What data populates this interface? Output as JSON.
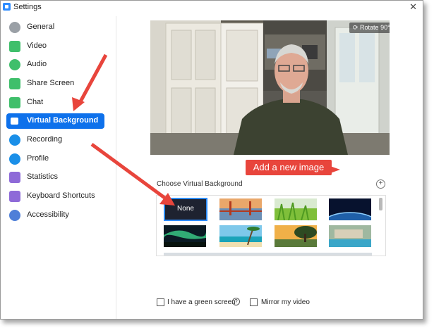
{
  "window": {
    "title": "Settings",
    "close_glyph": "✕"
  },
  "sidebar": {
    "items": [
      {
        "label": "General",
        "icon": "gear-icon",
        "color": "#9aa0a6"
      },
      {
        "label": "Video",
        "icon": "video-camera-icon",
        "color": "#3fbf6b"
      },
      {
        "label": "Audio",
        "icon": "headphones-icon",
        "color": "#3fbf6b"
      },
      {
        "label": "Share Screen",
        "icon": "share-screen-icon",
        "color": "#3fbf6b"
      },
      {
        "label": "Chat",
        "icon": "chat-bubble-icon",
        "color": "#3fbf6b"
      },
      {
        "label": "Virtual Background",
        "icon": "person-card-icon",
        "color": "#ffffff",
        "active": true
      },
      {
        "label": "Recording",
        "icon": "record-icon",
        "color": "#1a8fe8"
      },
      {
        "label": "Profile",
        "icon": "profile-icon",
        "color": "#1a8fe8"
      },
      {
        "label": "Statistics",
        "icon": "bar-chart-icon",
        "color": "#8e6ad8"
      },
      {
        "label": "Keyboard Shortcuts",
        "icon": "keyboard-icon",
        "color": "#8e6ad8"
      },
      {
        "label": "Accessibility",
        "icon": "accessibility-icon",
        "color": "#4f7fd8"
      }
    ]
  },
  "preview": {
    "rotate_label": "Rotate 90°"
  },
  "virtual_background": {
    "choose_label": "Choose Virtual Background",
    "add_glyph": "+",
    "none_label": "None",
    "thumbnails": [
      {
        "name": "none-thumbnail",
        "selected": true
      },
      {
        "name": "golden-gate-bridge-thumbnail"
      },
      {
        "name": "grass-thumbnail"
      },
      {
        "name": "earth-from-space-thumbnail"
      },
      {
        "name": "aurora-thumbnail"
      },
      {
        "name": "beach-palm-thumbnail"
      },
      {
        "name": "sunset-tree-thumbnail"
      },
      {
        "name": "resort-pool-thumbnail"
      }
    ]
  },
  "options": {
    "green_screen_label": "I have a green screen",
    "help_glyph": "?",
    "mirror_label": "Mirror my video"
  },
  "annotation": {
    "callout_text": "Add a new image",
    "accent_color": "#e8453c"
  },
  "colors": {
    "active_blue": "#0e71eb",
    "selection_blue": "#2d8cff"
  }
}
